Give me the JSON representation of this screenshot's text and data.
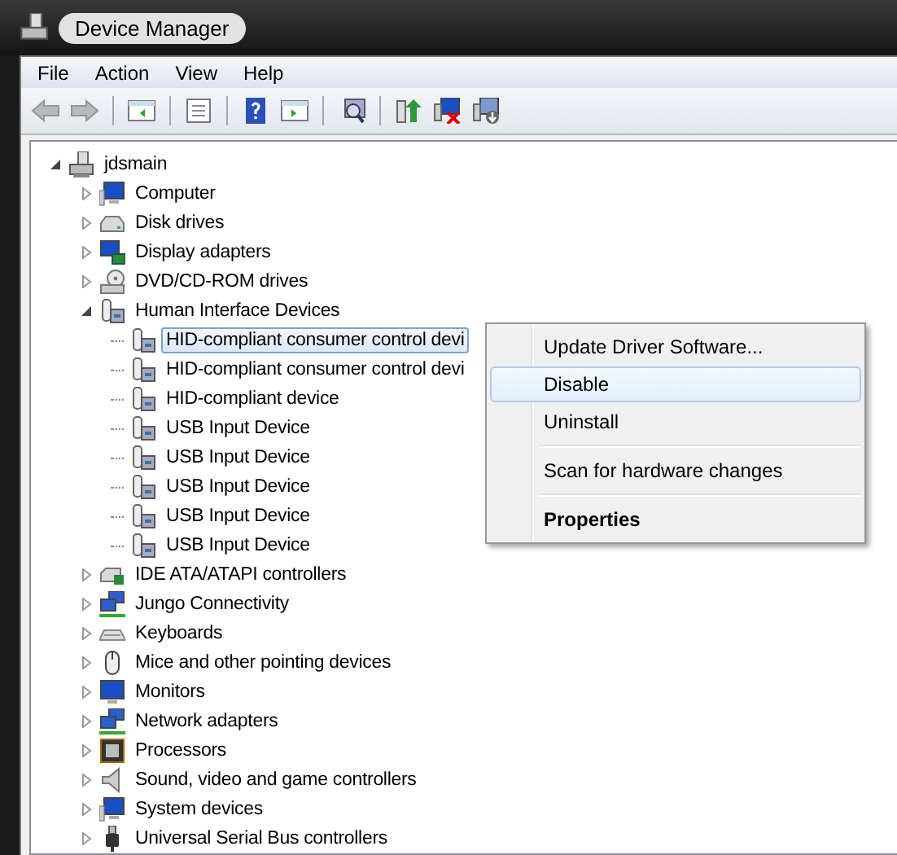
{
  "window": {
    "title": "Device Manager"
  },
  "menu_bar": [
    {
      "label": "File"
    },
    {
      "label": "Action"
    },
    {
      "label": "View"
    },
    {
      "label": "Help"
    }
  ],
  "toolbar": [
    {
      "buttons": [
        {
          "kind": "back",
          "disabled": true
        },
        {
          "kind": "forward",
          "disabled": true
        }
      ]
    },
    {
      "buttons": [
        {
          "kind": "console_tree",
          "disabled": false
        }
      ]
    },
    {
      "buttons": [
        {
          "kind": "properties",
          "disabled": false
        }
      ]
    },
    {
      "buttons": [
        {
          "kind": "help",
          "disabled": false
        },
        {
          "kind": "action_pane",
          "disabled": false
        }
      ]
    },
    {
      "buttons": [
        {
          "kind": "scan",
          "disabled": false
        }
      ]
    },
    {
      "buttons": [
        {
          "kind": "update",
          "disabled": false
        },
        {
          "kind": "uninstall",
          "disabled": false
        },
        {
          "kind": "disable",
          "disabled": false
        }
      ]
    }
  ],
  "tree": {
    "root": {
      "label": "jdsmain",
      "kind": "host",
      "expanded": true,
      "selected": false,
      "children": [
        {
          "label": "Computer",
          "kind": "computer",
          "expanded": false,
          "selected": false
        },
        {
          "label": "Disk drives",
          "kind": "disk",
          "expanded": false,
          "selected": false
        },
        {
          "label": "Display adapters",
          "kind": "display",
          "expanded": false,
          "selected": false
        },
        {
          "label": "DVD/CD-ROM drives",
          "kind": "dvd",
          "expanded": false,
          "selected": false
        },
        {
          "label": "Human Interface Devices",
          "kind": "hid",
          "expanded": true,
          "selected": false,
          "children": [
            {
              "label": "HID-compliant consumer control devi",
              "kind": "hid",
              "selected": true
            },
            {
              "label": "HID-compliant consumer control devi",
              "kind": "hid",
              "selected": false
            },
            {
              "label": "HID-compliant device",
              "kind": "hid",
              "selected": false
            },
            {
              "label": "USB Input Device",
              "kind": "hid",
              "selected": false
            },
            {
              "label": "USB Input Device",
              "kind": "hid",
              "selected": false
            },
            {
              "label": "USB Input Device",
              "kind": "hid",
              "selected": false
            },
            {
              "label": "USB Input Device",
              "kind": "hid",
              "selected": false
            },
            {
              "label": "USB Input Device",
              "kind": "hid",
              "selected": false
            }
          ]
        },
        {
          "label": "IDE ATA/ATAPI controllers",
          "kind": "ide",
          "expanded": false,
          "selected": false
        },
        {
          "label": "Jungo Connectivity",
          "kind": "network",
          "expanded": false,
          "selected": false
        },
        {
          "label": "Keyboards",
          "kind": "keyboard",
          "expanded": false,
          "selected": false
        },
        {
          "label": "Mice and other pointing devices",
          "kind": "mouse",
          "expanded": false,
          "selected": false
        },
        {
          "label": "Monitors",
          "kind": "monitor",
          "expanded": false,
          "selected": false
        },
        {
          "label": "Network adapters",
          "kind": "network",
          "expanded": false,
          "selected": false
        },
        {
          "label": "Processors",
          "kind": "processor",
          "expanded": false,
          "selected": false
        },
        {
          "label": "Sound, video and game controllers",
          "kind": "sound",
          "expanded": false,
          "selected": false
        },
        {
          "label": "System devices",
          "kind": "computer",
          "expanded": false,
          "selected": false
        },
        {
          "label": "Universal Serial Bus controllers",
          "kind": "usb",
          "expanded": false,
          "selected": false
        }
      ]
    }
  },
  "context_menu": [
    {
      "kind": "item",
      "label": "Update Driver Software...",
      "selected": false,
      "default": false
    },
    {
      "kind": "item",
      "label": "Disable",
      "selected": true,
      "default": false
    },
    {
      "kind": "item",
      "label": "Uninstall",
      "selected": false,
      "default": false
    },
    {
      "kind": "separator"
    },
    {
      "kind": "item",
      "label": "Scan for hardware changes",
      "selected": false,
      "default": false
    },
    {
      "kind": "separator"
    },
    {
      "kind": "item",
      "label": "Properties",
      "selected": false,
      "default": true
    }
  ]
}
